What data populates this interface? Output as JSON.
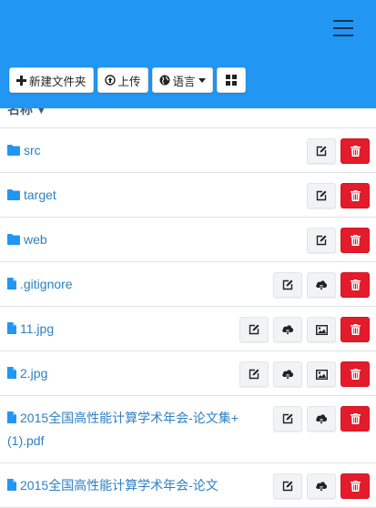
{
  "toolbar": {
    "new_folder_label": "新建文件夹",
    "upload_label": "上传",
    "language_label": "语言",
    "icons": [
      "plus-icon",
      "upload-icon",
      "globe-icon",
      "caret-down-icon",
      "grid-icon",
      "menu-icon"
    ]
  },
  "header": {
    "name_column_label": "名称",
    "sort_indicator": "▼"
  },
  "colors": {
    "primary": "#2196f3",
    "link": "#2d80c4",
    "danger": "#e31b2b"
  },
  "files": [
    {
      "name": "src",
      "type": "folder",
      "actions": [
        "rename",
        "delete"
      ]
    },
    {
      "name": "target",
      "type": "folder",
      "actions": [
        "rename",
        "delete"
      ]
    },
    {
      "name": "web",
      "type": "folder",
      "actions": [
        "rename",
        "delete"
      ]
    },
    {
      "name": ".gitignore",
      "type": "file",
      "actions": [
        "rename",
        "download",
        "delete"
      ]
    },
    {
      "name": "11.jpg",
      "type": "file",
      "actions": [
        "rename",
        "download",
        "preview",
        "delete"
      ]
    },
    {
      "name": "2.jpg",
      "type": "file",
      "actions": [
        "rename",
        "download",
        "preview",
        "delete"
      ]
    },
    {
      "name": "2015全国高性能计算学术年会-论文集+(1).pdf",
      "type": "file",
      "actions": [
        "rename",
        "download",
        "delete"
      ]
    },
    {
      "name": "2015全国高性能计算学术年会-论文",
      "type": "file",
      "actions": [
        "rename",
        "download",
        "delete"
      ]
    }
  ]
}
